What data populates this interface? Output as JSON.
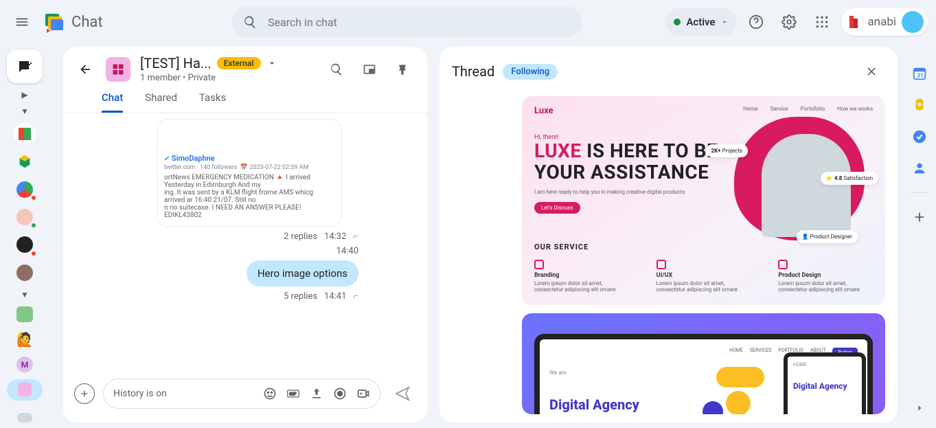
{
  "app": {
    "name": "Chat"
  },
  "search": {
    "placeholder": "Search in chat"
  },
  "status": {
    "label": "Active"
  },
  "brand_right": "anabi",
  "space": {
    "title": "[TEST] Ha...",
    "badge": "External",
    "subtitle": "1 member  •  Private"
  },
  "tabs": {
    "chat": "Chat",
    "shared": "Shared",
    "tasks": "Tasks"
  },
  "quote": {
    "name": "SimoDaphne",
    "meta_source": "twitter.com",
    "meta_followers": "140 followers",
    "meta_date": "2023-07-22 02:39 AM",
    "body1": "ortNews EMERGENCY MEDICATION 🔺 I arrived Yesterday in Edimburgh And my",
    "body2": "ing. It was sent by a KLM flight frome AMS whicg arrived ar 16:40 21/07. Still no",
    "body3": "n no suitecase. I NEED AN ANSWER PLEASE! EDIKL43802"
  },
  "msg1": {
    "replies": "2 replies",
    "time": "14:32"
  },
  "time_alone": "14:40",
  "bubble": "Hero image options",
  "msg2": {
    "replies": "5 replies",
    "time": "14:41"
  },
  "composer": {
    "history": "History is on"
  },
  "thread": {
    "title": "Thread",
    "following": "Following"
  },
  "mock1": {
    "brand": "Luxe",
    "nav": [
      "Home",
      "Service",
      "Portofolio",
      "How we works"
    ],
    "hi": "Hi, there!",
    "h1a": "LUXE",
    "h1b": " IS HERE TO BE",
    "h1c": "YOUR ASSISTANCE",
    "sub": "I am here ready to help you in making creative digital products",
    "cta": "Let's Discuss",
    "chip1a": "2K+",
    "chip1b": "Projects",
    "chip2a": "4.8",
    "chip2b": "Satisfaction",
    "chip3": "Product Designer",
    "svc_h": "OUR SERVICE",
    "svc": [
      {
        "t": "Branding",
        "d": "Lorem ipsum dolor sit amet, consectetur adipiscing elit ornare"
      },
      {
        "t": "UI/UX",
        "d": "Lorem ipsum dolor sit amet, consectetur adipiscing elit ornare"
      },
      {
        "t": "Product Design",
        "d": "Lorem ipsum dolor sit amet, consectetur adipiscing elit ornare"
      }
    ]
  },
  "mock2": {
    "nav": [
      "HOME",
      "SERVICES",
      "PORTFOLIO",
      "ABOUT"
    ],
    "btn": "Button",
    "small": "We are",
    "h": "Digital Agency",
    "h2": "Digital Agency"
  }
}
